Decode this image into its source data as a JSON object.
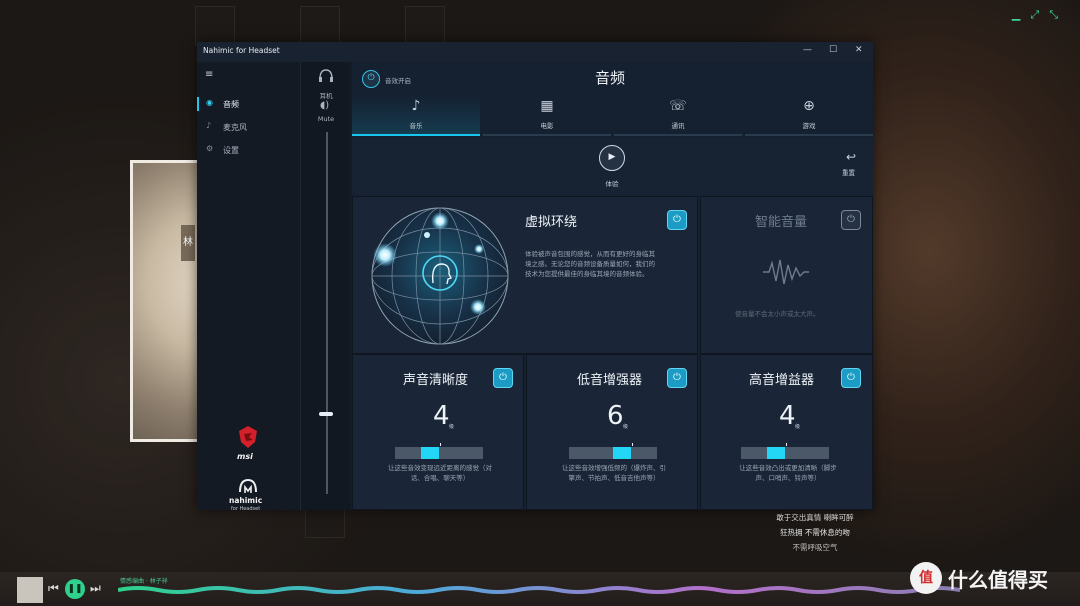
{
  "background": {
    "lyrics": [
      "敢于交出真情 喇眸可醉",
      "狂热拥 不需休息的吻",
      "不需呼吸空气"
    ],
    "watermark_text": "什么值得买",
    "watermark_logo": "值",
    "song_info": "情感编曲 · 林子祥"
  },
  "window": {
    "title": "Nahimic for Headset",
    "minimize_glyph": "—",
    "maximize_glyph": "☐",
    "close_glyph": "✕"
  },
  "sidebar": {
    "menu_glyph": "≡",
    "items": [
      {
        "label": "音频",
        "icon": "speaker-icon",
        "glyph": "◉"
      },
      {
        "label": "麦克风",
        "icon": "mic-icon",
        "glyph": "♪"
      },
      {
        "label": "设置",
        "icon": "gear-icon",
        "glyph": "⚙"
      }
    ],
    "brand1": "msi",
    "brand2": "nahimic",
    "brand2_sub": "for Headset"
  },
  "device": {
    "headset_label": "耳机",
    "mute_label": "Mute",
    "volume_level": 0.22
  },
  "main": {
    "title": "音频",
    "fx_label": "音效开启",
    "tabs": [
      {
        "label": "音乐",
        "icon": "music-note-icon",
        "glyph": "♪"
      },
      {
        "label": "电影",
        "icon": "clapperboard-icon",
        "glyph": "▦"
      },
      {
        "label": "通讯",
        "icon": "chat-icon",
        "glyph": "☏"
      },
      {
        "label": "游戏",
        "icon": "gamepad-icon",
        "glyph": "⊕"
      }
    ],
    "play_label": "体验",
    "reset_label": "重置"
  },
  "surround": {
    "title": "虚拟环绕",
    "desc": [
      "体验被声音包围的感觉，从而有更好的身临其",
      "境之感。无论您的音频设备质量如何，我们的",
      "技术为您提供最佳的身临其境的音频体验。"
    ]
  },
  "smart_volume": {
    "title": "智能音量",
    "desc": "使音量不会太小声或太大声。"
  },
  "clarity": {
    "title": "声音清晰度",
    "level": "4",
    "unit": "级",
    "fraction": 0.4,
    "desc": [
      "让这些音效变现远近距离的感觉（对",
      "话、合唱、聊天等）"
    ]
  },
  "bass": {
    "title": "低音增强器",
    "level": "6",
    "unit": "级",
    "fraction": 0.6,
    "desc": [
      "让这些音效增强低频的（爆炸声、引",
      "擎声、节拍声、低音吉他声等）"
    ]
  },
  "treble": {
    "title": "高音增益器",
    "level": "4",
    "unit": "级",
    "fraction": 0.4,
    "desc": [
      "让这些音效凸出或更加清晰（脚步",
      "声、口哨声、铃声等）"
    ]
  },
  "colors": {
    "accent": "#19c6ef",
    "panel": "#1a2637",
    "window": "#141b26"
  }
}
